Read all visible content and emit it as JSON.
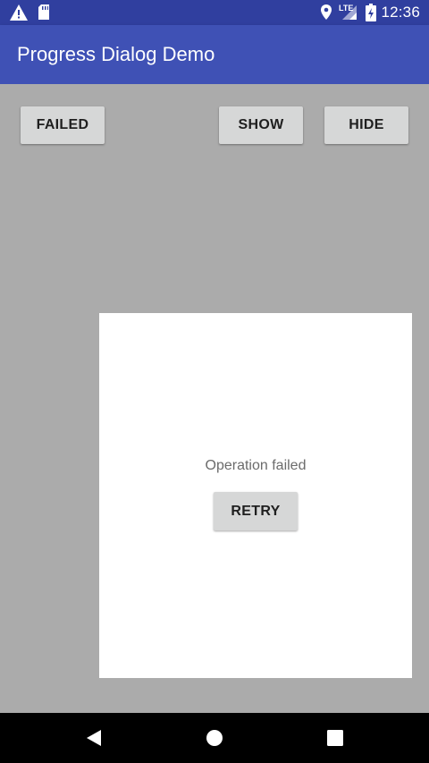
{
  "status_bar": {
    "time": "12:36",
    "network": "LTE",
    "icons": [
      "warning-icon",
      "sd-card-icon",
      "location-icon",
      "signal-icon",
      "battery-icon"
    ]
  },
  "app_bar": {
    "title": "Progress Dialog Demo"
  },
  "buttons": {
    "failed_label": "FAILED",
    "show_label": "SHOW",
    "hide_label": "HIDE"
  },
  "dialog": {
    "message": "Operation failed",
    "retry_label": "RETRY"
  },
  "nav_bar": {
    "icons": [
      "back-icon",
      "home-icon",
      "recents-icon"
    ]
  },
  "colors": {
    "status_bar": "#303f9f",
    "app_bar": "#3f51b5",
    "scrim_background": "#ababab",
    "button_background": "#d6d7d7",
    "dialog_background": "#ffffff"
  }
}
